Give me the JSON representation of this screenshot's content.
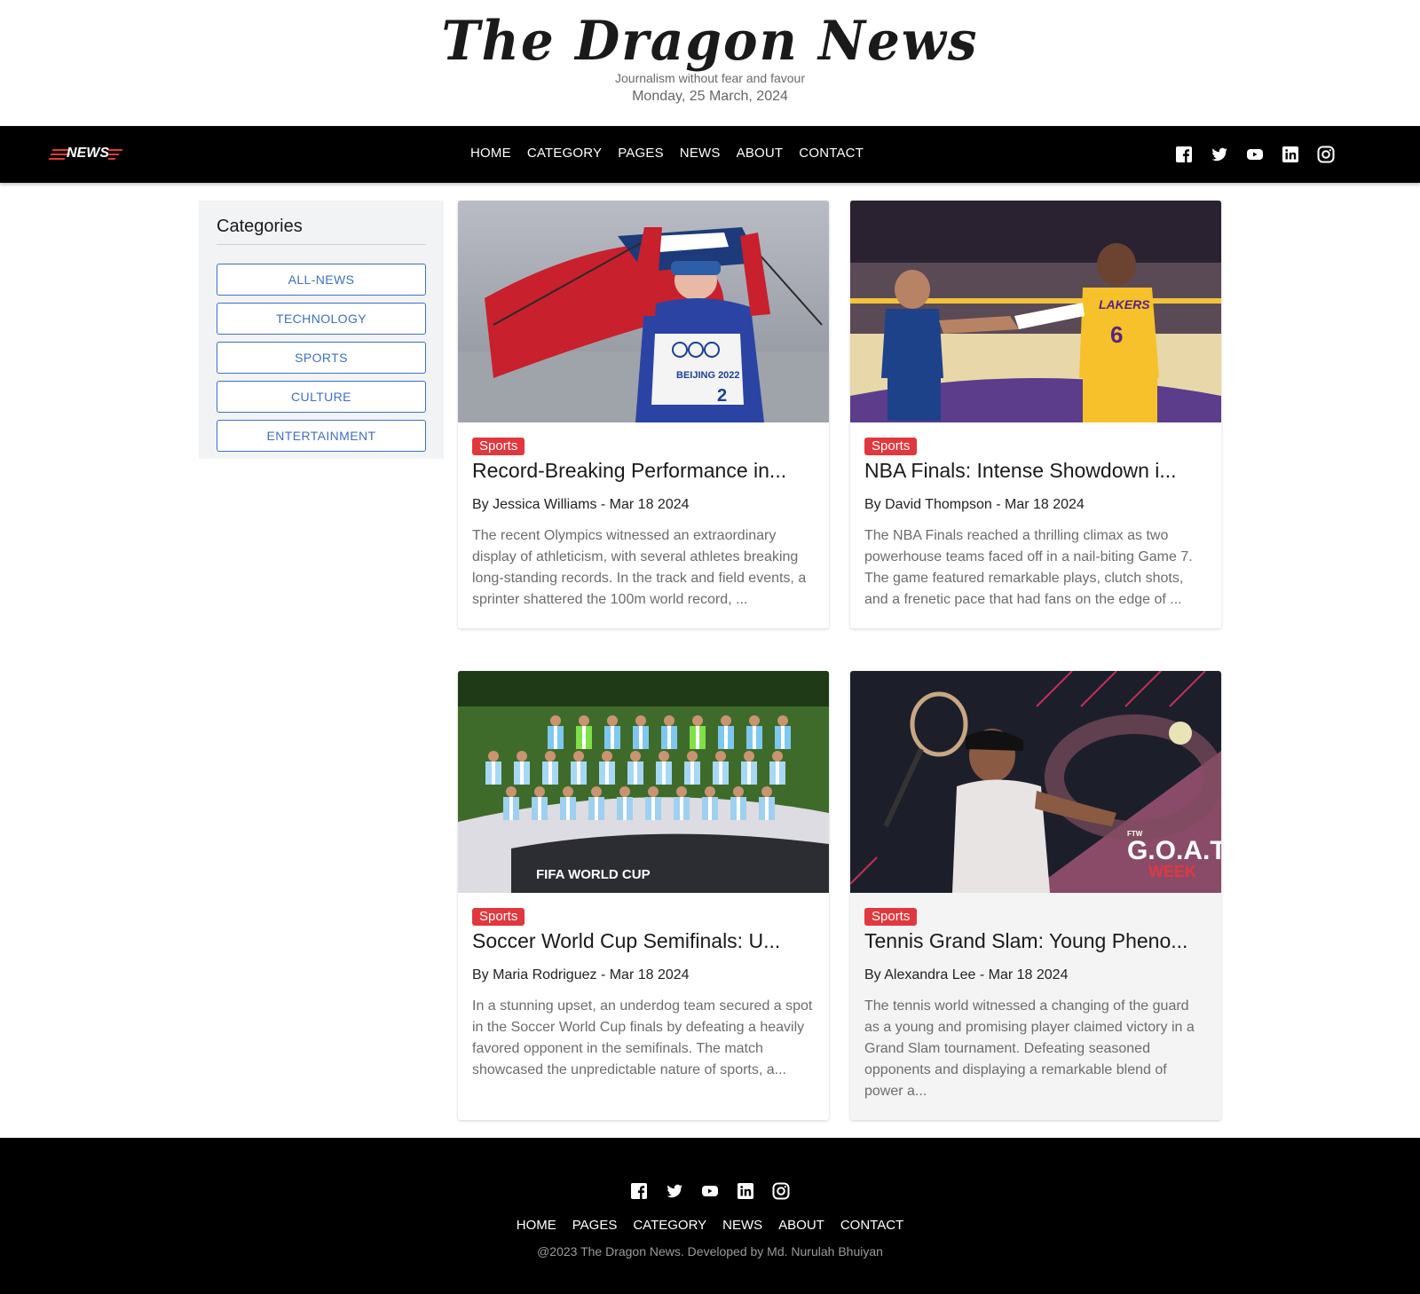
{
  "masthead": {
    "title": "The Dragon News",
    "tagline": "Journalism without fear and favour",
    "date": "Monday, 25 March, 2024"
  },
  "navbar": {
    "logo_text": "NEWS",
    "links": [
      "HOME",
      "CATEGORY",
      "PAGES",
      "NEWS",
      "ABOUT",
      "CONTACT"
    ],
    "social_icons": [
      "facebook-icon",
      "twitter-icon",
      "youtube-icon",
      "linkedin-icon",
      "instagram-icon"
    ]
  },
  "sidebar": {
    "heading": "Categories",
    "categories": [
      "ALL-NEWS",
      "TECHNOLOGY",
      "SPORTS",
      "CULTURE",
      "ENTERTAINMENT"
    ]
  },
  "cards": [
    {
      "category": "Sports",
      "title": "Record-Breaking Performance in...",
      "byline": "By Jessica Williams - Mar 18 2024",
      "excerpt": "The recent Olympics witnessed an extraordinary display of athleticism, with several athletes breaking long-standing records. In the track and field events, a sprinter shattered the 100m world record, ..."
    },
    {
      "category": "Sports",
      "title": "NBA Finals: Intense Showdown i...",
      "byline": "By David Thompson - Mar 18 2024",
      "excerpt": "The NBA Finals reached a thrilling climax as two powerhouse teams faced off in a nail-biting Game 7. The game featured remarkable plays, clutch shots, and a frenetic pace that had fans on the edge of ..."
    },
    {
      "category": "Sports",
      "title": "Soccer World Cup Semifinals: U...",
      "byline": "By Maria Rodriguez - Mar 18 2024",
      "excerpt": "In a stunning upset, an underdog team secured a spot in the Soccer World Cup finals by defeating a heavily favored opponent in the semifinals. The match showcased the unpredictable nature of sports, a..."
    },
    {
      "category": "Sports",
      "title": "Tennis Grand Slam: Young Pheno...",
      "byline": "By Alexandra Lee - Mar 18 2024",
      "excerpt": "The tennis world witnessed a changing of the guard as a young and promising player claimed victory in a Grand Slam tournament. Defeating seasoned opponents and displaying a remarkable blend of power a..."
    }
  ],
  "image_text": {
    "olympic_bib": "BEIJING 2022",
    "bib_number": "2",
    "jersey_team": "LAKERS",
    "jersey_number": "6",
    "banner": "FIFA WORLD CUP",
    "goat_top": "FTW",
    "goat_main": "G.O.A.T.",
    "goat_sub": "WEEK"
  },
  "footer": {
    "social_icons": [
      "facebook-icon",
      "twitter-icon",
      "youtube-icon",
      "linkedin-icon",
      "instagram-icon"
    ],
    "links": [
      "HOME",
      "PAGES",
      "CATEGORY",
      "NEWS",
      "ABOUT",
      "CONTACT"
    ],
    "copyright": "@2023 The Dragon News. Developed by Md. Nurulah Bhuiyan"
  },
  "colors": {
    "accent_red": "#e0383e",
    "category_blue": "#3f6fc5",
    "navbar_bg": "#000000"
  }
}
